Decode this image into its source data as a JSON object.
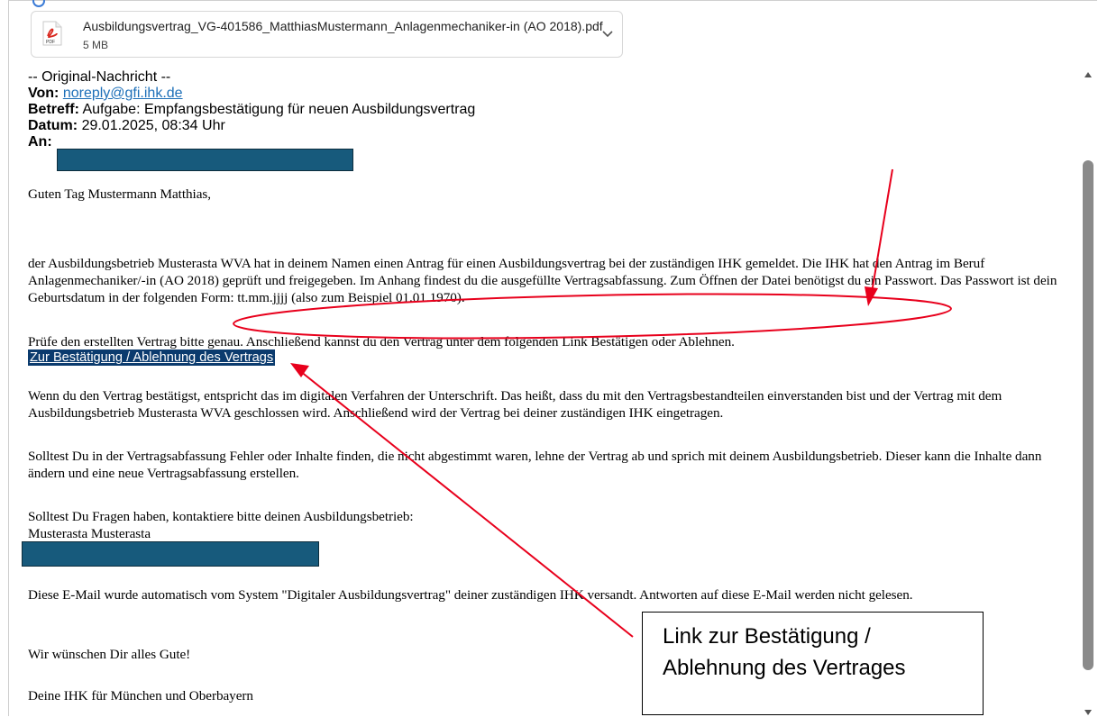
{
  "attachment": {
    "filename": "Ausbildungsvertrag_VG-401586_MatthiasMustermann_Anlagenmechaniker-in (AO 2018).pdf",
    "size": "5 MB",
    "icon": "pdf-icon",
    "menu_icon": "chevron-down-icon"
  },
  "header": {
    "original_label": "-- Original-Nachricht --",
    "from_label": "Von:",
    "from_value": "noreply@gfi.ihk.de",
    "subject_label": "Betreff:",
    "subject_value": "Aufgabe: Empfangsbestätigung für neuen Ausbildungsvertrag",
    "date_label": "Datum:",
    "date_value": "29.01.2025, 08:34 Uhr",
    "to_label": "An:"
  },
  "body": {
    "greeting": "Guten Tag Mustermann Matthias,",
    "para1": "der Ausbildungsbetrieb Musterasta WVA hat in deinem Namen einen Antrag für einen Ausbildungsvertrag bei der zuständigen IHK gemeldet. Die IHK hat den Antrag im Beruf Anlagenmechaniker/-in (AO 2018) geprüft und freigegeben. Im Anhang findest du die ausgefüllte Vertragsabfassung. Zum Öffnen der Datei benötigst du ein Passwort. Das Passwort ist dein Geburtsdatum in der folgenden Form: tt.mm.jjjj (also zum Beispiel 01.01.1970).",
    "para1b": "Prüfe den erstellten Vertrag bitte genau. Anschließend kannst du den Vertrag unter dem folgenden Link Bestätigen oder Ablehnen.",
    "link": "Zur Bestätigung / Ablehnung des Vertrags",
    "para2": "Wenn du den Vertrag bestätigst, entspricht das im digitalen Verfahren der Unterschrift. Das heißt, dass du mit den Vertragsbestandteilen einverstanden bist und der Vertrag mit dem Ausbildungsbetrieb Musterasta WVA geschlossen wird. Anschließend wird der Vertrag bei deiner zuständigen IHK eingetragen.",
    "para3": "Solltest Du in der Vertragsabfassung Fehler oder Inhalte finden, die nicht abgestimmt waren, lehne der Vertrag ab und sprich mit deinem Ausbildungsbetrieb. Dieser kann die Inhalte dann ändern und eine neue Vertragsabfassung erstellen.",
    "para4": "Solltest Du Fragen haben, kontaktiere bitte deinen Ausbildungsbetrieb:",
    "company": "Musterasta Musterasta",
    "para5": "Diese E-Mail wurde automatisch vom System \"Digitaler Ausbildungsvertrag\" deiner zuständigen IHK versandt. Antworten auf diese E-Mail werden nicht gelesen.",
    "closing": "Wir wünschen Dir alles Gute!",
    "signature": "Deine IHK für München und Oberbayern"
  },
  "annotation": {
    "callout_line1": "Link zur Bestätigung /",
    "callout_line2": "Ablehnung des Vertrages",
    "color": "#e8001c"
  },
  "colors": {
    "redaction": "#175a7c",
    "link_highlight": "#0b3b6e",
    "hyperlink": "#1d6fb8"
  }
}
